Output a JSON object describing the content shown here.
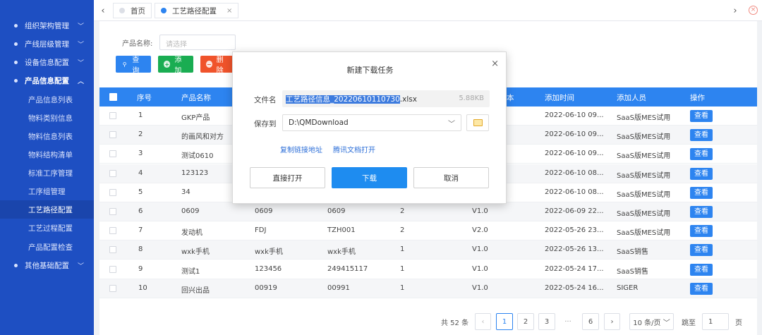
{
  "sidebar": {
    "items": [
      {
        "label": "组织架构管理",
        "type": "group",
        "chevron": "﹀"
      },
      {
        "label": "产线层级管理",
        "type": "group",
        "chevron": "﹀"
      },
      {
        "label": "设备信息配置",
        "type": "group",
        "chevron": "﹀"
      },
      {
        "label": "产品信息配置",
        "type": "group",
        "chevron": "︿"
      },
      {
        "label": "产品信息列表",
        "type": "sub"
      },
      {
        "label": "物料类别信息",
        "type": "sub"
      },
      {
        "label": "物料信息列表",
        "type": "sub"
      },
      {
        "label": "物料结构清单",
        "type": "sub"
      },
      {
        "label": "标准工序管理",
        "type": "sub"
      },
      {
        "label": "工序组管理",
        "type": "sub"
      },
      {
        "label": "工艺路径配置",
        "type": "sub",
        "active": true
      },
      {
        "label": "工艺过程配置",
        "type": "sub"
      },
      {
        "label": "产品配置检查",
        "type": "sub"
      },
      {
        "label": "其他基础配置",
        "type": "group",
        "chevron": "﹀"
      }
    ]
  },
  "tabs": [
    {
      "label": "首页",
      "dot_color": "#dcdfe6"
    },
    {
      "label": "工艺路径配置",
      "dot_color": "#2d84f0",
      "close": "×"
    }
  ],
  "tab_nav": {
    "prev": "‹",
    "next": "›",
    "close_all": "×"
  },
  "search": {
    "label": "产品名称:",
    "placeholder": "请选择"
  },
  "toolbar": {
    "query": "查询",
    "add": "添加",
    "delete": "删除"
  },
  "colors": {
    "primary": "#2d84f0",
    "success": "#1aad52",
    "danger": "#f0532b",
    "sidebar": "#1e4fc2"
  },
  "table": {
    "headers": {
      "seq": "序号",
      "name": "产品名称",
      "version": "本",
      "added_time": "添加时间",
      "added_by": "添加人员",
      "action": "操作"
    },
    "rows": [
      {
        "seq": "1",
        "name": "GKP产品",
        "code": "",
        "route": "",
        "count": "",
        "version": "",
        "time": "2022-06-10 09...",
        "user": "SaaS版MES试用",
        "action": "查看"
      },
      {
        "seq": "2",
        "name": "的画风和对方",
        "code": "",
        "route": "",
        "count": "",
        "version": "",
        "time": "2022-06-10 09...",
        "user": "SaaS版MES试用",
        "action": "查看"
      },
      {
        "seq": "3",
        "name": "测试0610",
        "code": "",
        "route": "",
        "count": "",
        "version": "",
        "time": "2022-06-10 09...",
        "user": "SaaS版MES试用",
        "action": "查看"
      },
      {
        "seq": "4",
        "name": "123123",
        "code": "",
        "route": "",
        "count": "",
        "version": "",
        "time": "2022-06-10 08...",
        "user": "SaaS版MES试用",
        "action": "查看"
      },
      {
        "seq": "5",
        "name": "34",
        "code": "",
        "route": "",
        "count": "",
        "version": "",
        "time": "2022-06-10 08...",
        "user": "SaaS版MES试用",
        "action": "查看"
      },
      {
        "seq": "6",
        "name": "0609",
        "code": "0609",
        "route": "0609",
        "count": "2",
        "version": "V1.0",
        "time": "2022-06-09 22...",
        "user": "SaaS版MES试用",
        "action": "查看"
      },
      {
        "seq": "7",
        "name": "发动机",
        "code": "FDJ",
        "route": "TZH001",
        "count": "2",
        "version": "V2.0",
        "time": "2022-05-26 23...",
        "user": "SaaS版MES试用",
        "action": "查看"
      },
      {
        "seq": "8",
        "name": "wxk手机",
        "code": "wxk手机",
        "route": "wxk手机",
        "count": "1",
        "version": "V1.0",
        "time": "2022-05-26 13...",
        "user": "SaaS销售",
        "action": "查看"
      },
      {
        "seq": "9",
        "name": "测试1",
        "code": "123456",
        "route": "249415117",
        "count": "1",
        "version": "V1.0",
        "time": "2022-05-24 17...",
        "user": "SaaS销售",
        "action": "查看"
      },
      {
        "seq": "10",
        "name": "回兴出品",
        "code": "00919",
        "route": "00991",
        "count": "1",
        "version": "V1.0",
        "time": "2022-05-24 16...",
        "user": "SIGER",
        "action": "查看"
      }
    ]
  },
  "pagination": {
    "total": "共 52 条",
    "prev": "‹",
    "pages": [
      "1",
      "2",
      "3"
    ],
    "ellipsis": "···",
    "last": "6",
    "next": "›",
    "page_size": "10 条/页 ﹀",
    "goto_label": "跳至",
    "goto_value": "1",
    "page_suffix": "页"
  },
  "dialog": {
    "title": "新建下载任务",
    "close": "×",
    "filename_label": "文件名",
    "filename_selected": "工艺路径信息_20220610110730",
    "filename_ext": ".xlsx",
    "file_size": "5.88KB",
    "save_label": "保存到",
    "save_path": "D:\\QMDownload",
    "copy_link": "复制链接地址",
    "open_tencent_doc": "腾讯文档打开",
    "open_direct": "直接打开",
    "download": "下载",
    "cancel": "取消"
  }
}
